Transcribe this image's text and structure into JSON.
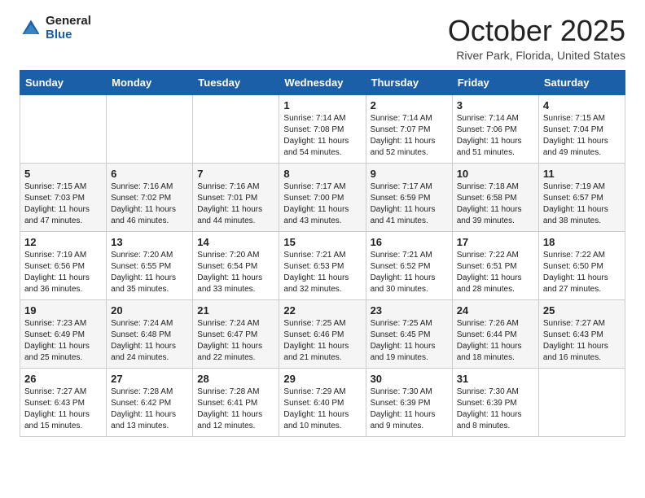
{
  "logo": {
    "general": "General",
    "blue": "Blue"
  },
  "title": "October 2025",
  "location": "River Park, Florida, United States",
  "days_of_week": [
    "Sunday",
    "Monday",
    "Tuesday",
    "Wednesday",
    "Thursday",
    "Friday",
    "Saturday"
  ],
  "weeks": [
    [
      {
        "day": "",
        "info": ""
      },
      {
        "day": "",
        "info": ""
      },
      {
        "day": "",
        "info": ""
      },
      {
        "day": "1",
        "info": "Sunrise: 7:14 AM\nSunset: 7:08 PM\nDaylight: 11 hours\nand 54 minutes."
      },
      {
        "day": "2",
        "info": "Sunrise: 7:14 AM\nSunset: 7:07 PM\nDaylight: 11 hours\nand 52 minutes."
      },
      {
        "day": "3",
        "info": "Sunrise: 7:14 AM\nSunset: 7:06 PM\nDaylight: 11 hours\nand 51 minutes."
      },
      {
        "day": "4",
        "info": "Sunrise: 7:15 AM\nSunset: 7:04 PM\nDaylight: 11 hours\nand 49 minutes."
      }
    ],
    [
      {
        "day": "5",
        "info": "Sunrise: 7:15 AM\nSunset: 7:03 PM\nDaylight: 11 hours\nand 47 minutes."
      },
      {
        "day": "6",
        "info": "Sunrise: 7:16 AM\nSunset: 7:02 PM\nDaylight: 11 hours\nand 46 minutes."
      },
      {
        "day": "7",
        "info": "Sunrise: 7:16 AM\nSunset: 7:01 PM\nDaylight: 11 hours\nand 44 minutes."
      },
      {
        "day": "8",
        "info": "Sunrise: 7:17 AM\nSunset: 7:00 PM\nDaylight: 11 hours\nand 43 minutes."
      },
      {
        "day": "9",
        "info": "Sunrise: 7:17 AM\nSunset: 6:59 PM\nDaylight: 11 hours\nand 41 minutes."
      },
      {
        "day": "10",
        "info": "Sunrise: 7:18 AM\nSunset: 6:58 PM\nDaylight: 11 hours\nand 39 minutes."
      },
      {
        "day": "11",
        "info": "Sunrise: 7:19 AM\nSunset: 6:57 PM\nDaylight: 11 hours\nand 38 minutes."
      }
    ],
    [
      {
        "day": "12",
        "info": "Sunrise: 7:19 AM\nSunset: 6:56 PM\nDaylight: 11 hours\nand 36 minutes."
      },
      {
        "day": "13",
        "info": "Sunrise: 7:20 AM\nSunset: 6:55 PM\nDaylight: 11 hours\nand 35 minutes."
      },
      {
        "day": "14",
        "info": "Sunrise: 7:20 AM\nSunset: 6:54 PM\nDaylight: 11 hours\nand 33 minutes."
      },
      {
        "day": "15",
        "info": "Sunrise: 7:21 AM\nSunset: 6:53 PM\nDaylight: 11 hours\nand 32 minutes."
      },
      {
        "day": "16",
        "info": "Sunrise: 7:21 AM\nSunset: 6:52 PM\nDaylight: 11 hours\nand 30 minutes."
      },
      {
        "day": "17",
        "info": "Sunrise: 7:22 AM\nSunset: 6:51 PM\nDaylight: 11 hours\nand 28 minutes."
      },
      {
        "day": "18",
        "info": "Sunrise: 7:22 AM\nSunset: 6:50 PM\nDaylight: 11 hours\nand 27 minutes."
      }
    ],
    [
      {
        "day": "19",
        "info": "Sunrise: 7:23 AM\nSunset: 6:49 PM\nDaylight: 11 hours\nand 25 minutes."
      },
      {
        "day": "20",
        "info": "Sunrise: 7:24 AM\nSunset: 6:48 PM\nDaylight: 11 hours\nand 24 minutes."
      },
      {
        "day": "21",
        "info": "Sunrise: 7:24 AM\nSunset: 6:47 PM\nDaylight: 11 hours\nand 22 minutes."
      },
      {
        "day": "22",
        "info": "Sunrise: 7:25 AM\nSunset: 6:46 PM\nDaylight: 11 hours\nand 21 minutes."
      },
      {
        "day": "23",
        "info": "Sunrise: 7:25 AM\nSunset: 6:45 PM\nDaylight: 11 hours\nand 19 minutes."
      },
      {
        "day": "24",
        "info": "Sunrise: 7:26 AM\nSunset: 6:44 PM\nDaylight: 11 hours\nand 18 minutes."
      },
      {
        "day": "25",
        "info": "Sunrise: 7:27 AM\nSunset: 6:43 PM\nDaylight: 11 hours\nand 16 minutes."
      }
    ],
    [
      {
        "day": "26",
        "info": "Sunrise: 7:27 AM\nSunset: 6:43 PM\nDaylight: 11 hours\nand 15 minutes."
      },
      {
        "day": "27",
        "info": "Sunrise: 7:28 AM\nSunset: 6:42 PM\nDaylight: 11 hours\nand 13 minutes."
      },
      {
        "day": "28",
        "info": "Sunrise: 7:28 AM\nSunset: 6:41 PM\nDaylight: 11 hours\nand 12 minutes."
      },
      {
        "day": "29",
        "info": "Sunrise: 7:29 AM\nSunset: 6:40 PM\nDaylight: 11 hours\nand 10 minutes."
      },
      {
        "day": "30",
        "info": "Sunrise: 7:30 AM\nSunset: 6:39 PM\nDaylight: 11 hours\nand 9 minutes."
      },
      {
        "day": "31",
        "info": "Sunrise: 7:30 AM\nSunset: 6:39 PM\nDaylight: 11 hours\nand 8 minutes."
      },
      {
        "day": "",
        "info": ""
      }
    ]
  ]
}
